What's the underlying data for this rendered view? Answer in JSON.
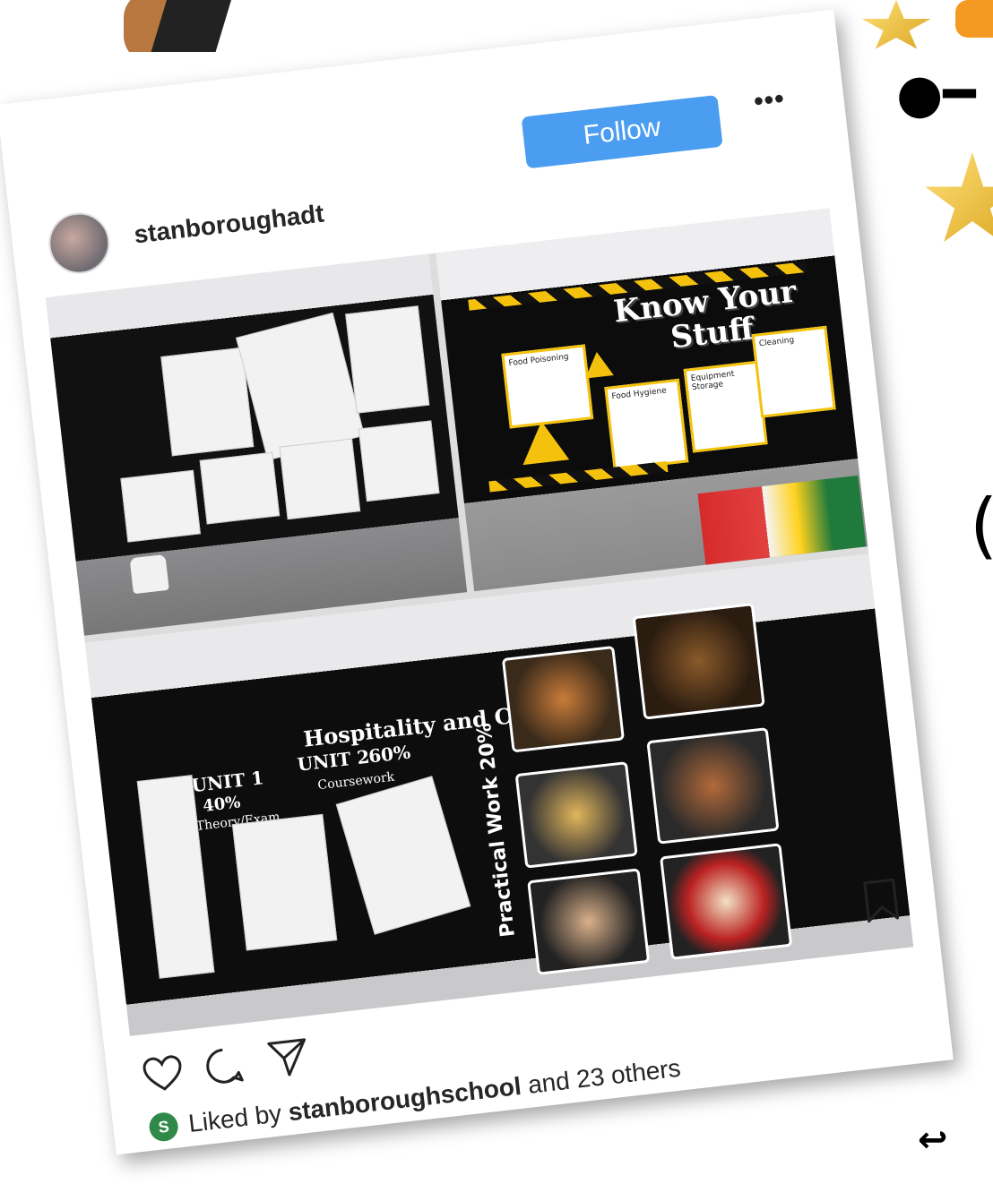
{
  "post": {
    "username": "stanboroughadt",
    "follow_label": "Follow",
    "more_label": "•••",
    "liked_prefix": "Liked by",
    "liked_user": "stanboroughschool",
    "liked_suffix": "and 23 others",
    "liked_logo_letter": "S"
  },
  "photos": {
    "board2": {
      "title_line1": "Know Your",
      "title_line2": "Stuff",
      "note1": "Food Poisoning",
      "note2": "Food Hygiene",
      "note3": "Equipment Storage",
      "note4": "Cleaning"
    },
    "board3": {
      "title": "Hospitality and Catering",
      "unit1": "UNIT 1",
      "unit1_pct": "40%",
      "unit1_sub": "Theory/Exam",
      "unit2": "UNIT 2",
      "unit2_pct": "60%",
      "unit2_sub": "Coursework",
      "practical": "Practical Work 20%"
    }
  },
  "icons": [
    "heart-icon",
    "comment-icon",
    "share-icon",
    "bookmark-icon"
  ]
}
